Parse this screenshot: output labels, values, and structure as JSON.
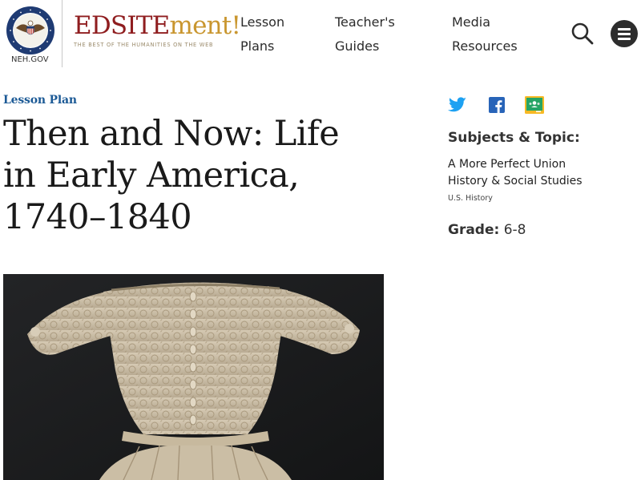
{
  "header": {
    "org_label": "NEH.GOV",
    "brand": {
      "name_part1": "EDSITE",
      "name_part2": "ment!",
      "tagline": "THE BEST OF THE HUMANITIES ON THE WEB"
    },
    "nav": [
      {
        "line1": "Lesson",
        "line2": "Plans"
      },
      {
        "line1": "Teacher's",
        "line2": "Guides"
      },
      {
        "line1": "Media",
        "line2": "Resources"
      }
    ],
    "search_icon": "search-icon",
    "menu_icon": "hamburger-menu-icon"
  },
  "main": {
    "eyebrow": "Lesson Plan",
    "title": "Then and Now: Life in Early America, 1740–1840",
    "hero_image_icon": "embroidered-bodice-image"
  },
  "sidebar": {
    "share": [
      {
        "icon": "twitter-icon"
      },
      {
        "icon": "facebook-icon"
      },
      {
        "icon": "google-classroom-icon"
      }
    ],
    "subjects_heading": "Subjects & Topic:",
    "subjects": [
      "A More Perfect Union",
      "History & Social Studies"
    ],
    "subject_sub": "U.S. History",
    "grade_label": "Grade:",
    "grade_value": "6-8"
  },
  "colors": {
    "brand_red": "#8f1d1f",
    "brand_gold": "#c9962f",
    "link_blue": "#1c5a96",
    "seal_blue": "#1f3b73",
    "twitter_blue": "#1da1f2",
    "facebook_blue": "#1877f2",
    "classroom_green": "#25a464",
    "classroom_yellow": "#f7b924"
  }
}
